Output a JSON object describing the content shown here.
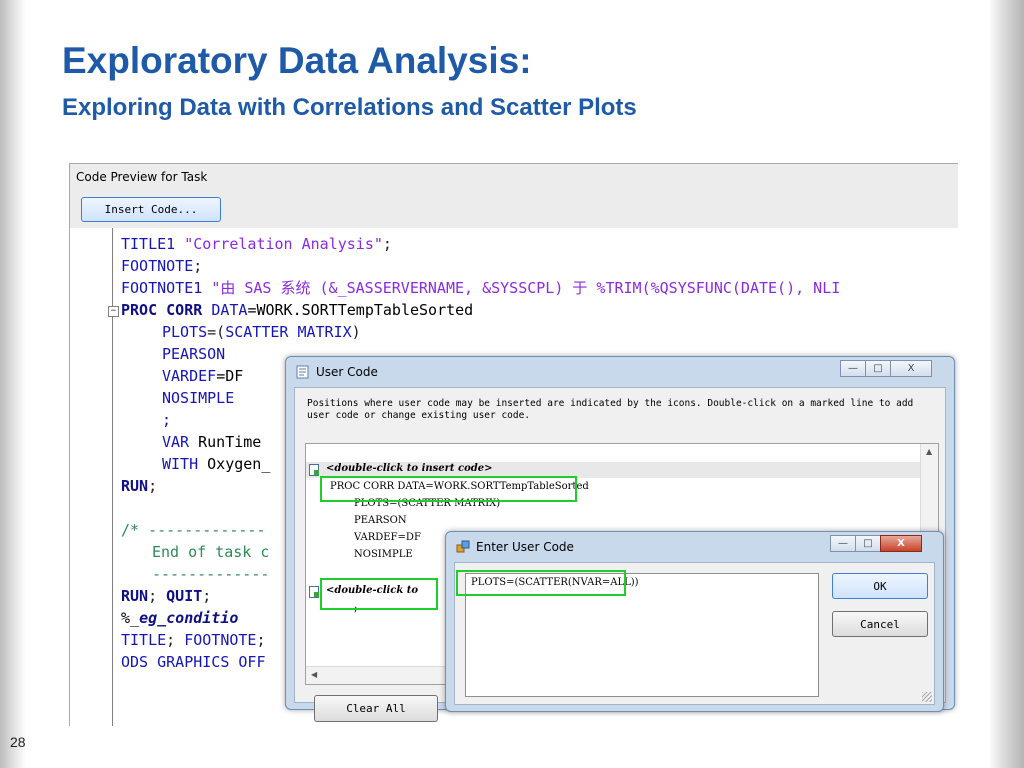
{
  "slide": {
    "title": "Exploratory Data Analysis:",
    "subtitle": "Exploring Data with Correlations and Scatter Plots",
    "page_number": "28"
  },
  "code_window": {
    "title": "Code Preview for Task",
    "insert_button": "Insert Code...",
    "fold_marker": "−",
    "lines": [
      {
        "parts": [
          "TITLE1",
          " ",
          "\"Correlation Analysis\"",
          ";"
        ]
      },
      {
        "parts": [
          "FOOTNOTE",
          ";"
        ]
      },
      {
        "parts": [
          "FOOTNOTE1",
          " ",
          "\"由 SAS 系统 (&_SASSERVERNAME, &SYSSCPL) 于 %TRIM(%QSYSFUNC(DATE(), NLI"
        ]
      },
      {
        "parts": [
          "PROC CORR",
          " ",
          "DATA",
          "=WORK.SORTTempTableSorted"
        ]
      },
      {
        "parts": [
          "PLOTS",
          "=(",
          "SCATTER MATRIX",
          ")"
        ]
      },
      {
        "parts": [
          "PEARSON"
        ]
      },
      {
        "parts": [
          "VARDEF",
          "=DF"
        ]
      },
      {
        "parts": [
          "NOSIMPLE"
        ]
      },
      {
        "parts": [
          ";"
        ]
      },
      {
        "parts": [
          "VAR",
          " RunTime"
        ]
      },
      {
        "parts": [
          "WITH",
          " Oxygen_"
        ]
      },
      {
        "parts": [
          "RUN",
          ";"
        ]
      },
      {
        "parts": [
          "/* -------------"
        ]
      },
      {
        "parts": [
          "End of task c"
        ]
      },
      {
        "parts": [
          "-------------"
        ]
      },
      {
        "parts": [
          "RUN",
          "; ",
          "QUIT",
          ";"
        ]
      },
      {
        "parts": [
          "%_",
          "eg_conditio"
        ]
      },
      {
        "parts": [
          "TITLE",
          "; ",
          "FOOTNOTE",
          ";"
        ]
      },
      {
        "parts": [
          "ODS GRAPHICS OFF"
        ]
      }
    ]
  },
  "user_code_dialog": {
    "title": "User Code",
    "description": "Positions where user code may be inserted are indicated by the icons. Double-click on a marked line to add user code or change existing user code.",
    "list": [
      {
        "text": "<double-click to insert code>",
        "marker": true,
        "emphasis": true
      },
      {
        "text": "PROC CORR DATA=WORK.SORTTempTableSorted",
        "marker": false,
        "emphasis": false
      },
      {
        "text": "PLOTS=(SCATTER MATRIX)",
        "marker": false,
        "emphasis": false
      },
      {
        "text": "PEARSON",
        "marker": false,
        "emphasis": false
      },
      {
        "text": "VARDEF=DF",
        "marker": false,
        "emphasis": false
      },
      {
        "text": "NOSIMPLE",
        "marker": false,
        "emphasis": false
      },
      {
        "text": "<double-click to",
        "marker": true,
        "emphasis": true
      },
      {
        "text": ";",
        "marker": false,
        "emphasis": false
      }
    ],
    "clear_all_button": "Clear All",
    "window_buttons": {
      "minimize": "—",
      "maximize": "□",
      "close": "X"
    }
  },
  "enter_user_code_dialog": {
    "title": "Enter User Code",
    "code_value": "PLOTS=(SCATTER(NVAR=ALL))",
    "ok_button": "OK",
    "cancel_button": "Cancel",
    "window_buttons": {
      "minimize": "—",
      "maximize": "□",
      "close": "X"
    }
  },
  "colors": {
    "title_blue": "#1e5aa8",
    "keyword_blue": "#1515b8",
    "string_purple": "#8a2be2",
    "comment_green": "#2e8b57",
    "highlight_green": "#1ecf2a"
  },
  "icons": [
    "code-marker-icon",
    "user-code-dialog-icon",
    "enter-user-code-dialog-icon",
    "minimize-icon",
    "maximize-icon",
    "close-icon"
  ]
}
